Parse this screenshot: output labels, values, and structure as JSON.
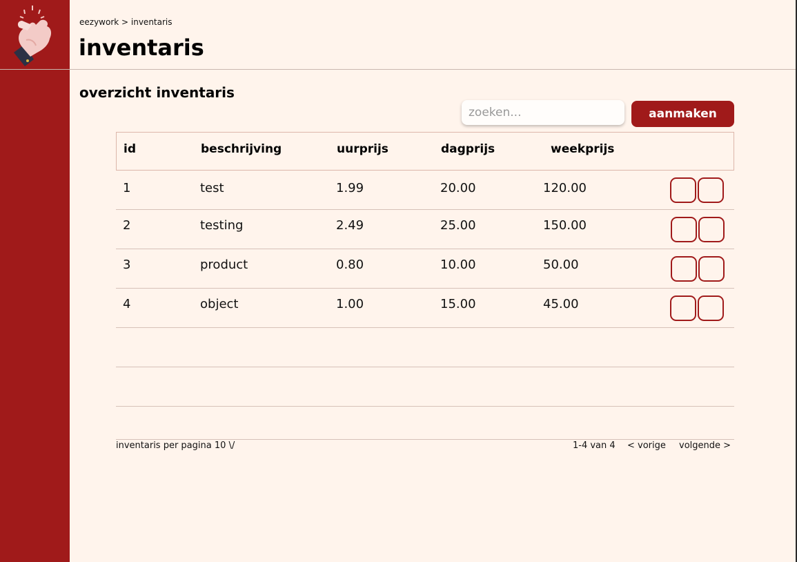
{
  "breadcrumb": "eezywork > inventaris",
  "page_title": "inventaris",
  "section_title": "overzicht inventaris",
  "search": {
    "placeholder": "zoeken..."
  },
  "create_button": "aanmaken",
  "table": {
    "headers": [
      "id",
      "beschrijving",
      "uurprijs",
      "dagprijs",
      "weekprijs"
    ],
    "rows": [
      {
        "id": "1",
        "beschrijving": "test",
        "uurprijs": "1.99",
        "dagprijs": "20.00",
        "weekprijs": "120.00"
      },
      {
        "id": "2",
        "beschrijving": "testing",
        "uurprijs": "2.49",
        "dagprijs": "25.00",
        "weekprijs": "150.00"
      },
      {
        "id": "3",
        "beschrijving": "product",
        "uurprijs": "0.80",
        "dagprijs": "10.00",
        "weekprijs": "50.00"
      },
      {
        "id": "4",
        "beschrijving": "object",
        "uurprijs": "1.00",
        "dagprijs": "15.00",
        "weekprijs": "45.00"
      }
    ]
  },
  "pagination": {
    "per_page_label": "inventaris per pagina 10 \\/",
    "range": "1-4 van 4",
    "prev": "< vorige",
    "next": "volgende >"
  },
  "colors": {
    "brand": "#a01a1a",
    "background": "#fff4ec"
  },
  "icons": {
    "logo": "pointing-hand-icon"
  }
}
